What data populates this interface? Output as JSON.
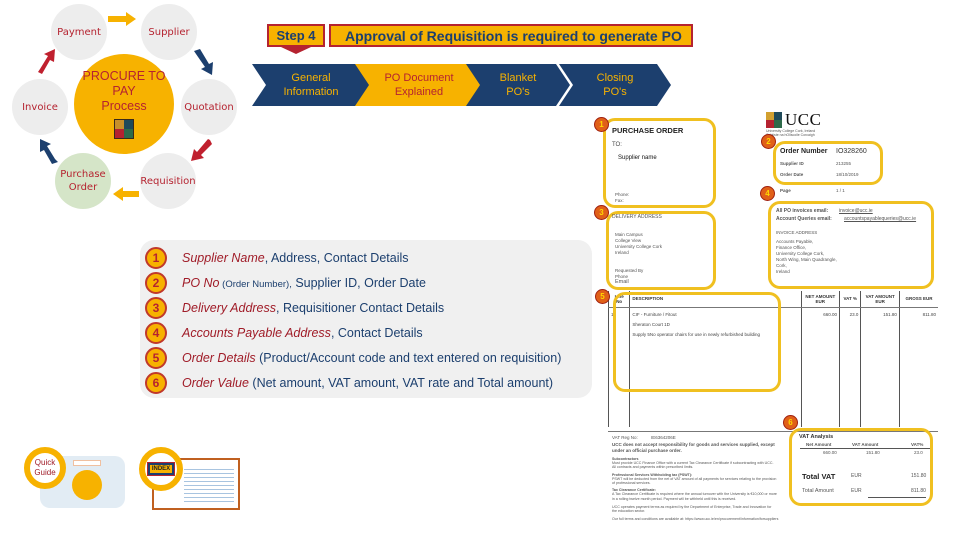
{
  "cycle": {
    "center_line1": "PROCURE TO PAY",
    "center_line2": "Process",
    "nodes": {
      "payment": "Payment",
      "supplier": "Supplier",
      "quotation": "Quotation",
      "requisition": "Requisition",
      "purchase_order_line1": "Purchase",
      "purchase_order_line2": "Order",
      "invoice": "Invoice"
    },
    "colors": {
      "gold": "#f7b200",
      "navy": "#1c3f6e",
      "red": "#b52330",
      "grey": "#ededed",
      "green": "#d5e5c8"
    }
  },
  "header": {
    "step_label": "Step 4",
    "title": "Approval of Requisition is required to generate PO"
  },
  "chevrons": [
    {
      "line1": "General",
      "line2": "Information",
      "active": false
    },
    {
      "line1": "PO Document",
      "line2": "Explained",
      "active": true
    },
    {
      "line1": "Blanket",
      "line2": "PO's",
      "active": false
    },
    {
      "line1": "Closing",
      "line2": "PO's",
      "active": false
    }
  ],
  "list": [
    {
      "num": "1",
      "em": "Supplier Name",
      "rest": ", Address, Contact Details"
    },
    {
      "num": "2",
      "em": "PO No",
      "small": " (Order Number),",
      "rest": " Supplier ID, Order Date"
    },
    {
      "num": "3",
      "em": "Delivery Address",
      "rest": ", Requisitioner Contact Details"
    },
    {
      "num": "4",
      "em": "Accounts Payable Address",
      "rest": ", Contact Details"
    },
    {
      "num": "5",
      "em": "Order Details",
      "rest": " (Product/Account code and text entered on requisition)"
    },
    {
      "num": "6",
      "em": "Order Value",
      "rest": " (Net amount, VAT amount, VAT rate and Total amount)"
    }
  ],
  "po_document": {
    "heading": "PURCHASE ORDER",
    "to_label": "TO:",
    "supplier_name": "Supplier name",
    "phone_label": "Phone:",
    "fax_label": "Fax:",
    "logo_text": "UCC",
    "logo_sub1": "University College Cork, Ireland",
    "logo_sub2": "Coláiste na hOllscoile Corcaigh",
    "order_number_label": "Order Number",
    "order_number": "IO328260",
    "supplier_id_label": "Supplier ID",
    "supplier_id": "213255",
    "order_date_label": "Order Date",
    "order_date": "18/10/2019",
    "page_label": "Page",
    "page_value": "1 / 1",
    "delivery_heading": "DELIVERY ADDRESS",
    "delivery_lines": [
      "Main Campus",
      "College View",
      "University College Cork",
      "Ireland"
    ],
    "requested_by_label": "Requested By",
    "requested_phone": "Phone",
    "requested_email": "Email",
    "invoices_email_label": "All PO invoices email:",
    "invoices_email": "invoice@ucc.ie",
    "queries_email_label": "Account Queries email:",
    "queries_email": "accountspayablequeries@ucc.ie",
    "invoice_heading": "INVOICE ADDRESS",
    "invoice_lines": [
      "Accounts Payable,",
      "Finance Office,",
      "University College Cork,",
      "North Wing, Main Quadrangle,",
      "Cork,",
      "Ireland"
    ],
    "table_headers": [
      "Line No",
      "DESCRIPTION",
      "NET AMOUNT EUR",
      "VAT %",
      "VAT AMOUNT EUR",
      "GROSS EUR"
    ],
    "line_item": {
      "line_no": "1",
      "category": "CIF - Furniture / Fitout",
      "location": "Sheraton Court 1D",
      "description": "Supply 5No operator chairs for use in newly refurbished building",
      "net_amount": "660.00",
      "vat_pct": "23.0",
      "vat_amount": "151.80",
      "gross": "811.80"
    },
    "vat_reg_label": "VAT Reg No:",
    "vat_reg": "IE6364206E",
    "disclaimer": "UCC does not accept responsibility for goods and services supplied, except under an official purchase order.",
    "notes": [
      {
        "title": "Subcontractors",
        "body": "Must provide UCC Finance Office with a current Tax Clearance Certificate if subcontracting with UCC. All contracts and payments within prescribed limits."
      },
      {
        "title": "Professional Services Withholding tax (PSWT):",
        "body": "PSWT will be deducted from the net of VAT amount of all payments for services relating to the provision of professional services."
      },
      {
        "title": "Tax Clearance Certificate:",
        "body": "A Tax Clearance Certificate is required where the annual turnover with the University is €10,000 or more in a rolling twelve month period. Payment will be withheld until this is received."
      },
      {
        "title": "",
        "body": "UCC operates payment terms as required by the Department of Enterprise, Trade and Innovation for the education sector."
      },
      {
        "title": "",
        "body": "Our full terms and conditions are available at: https://www.ucc.ie/en/procurement/information/forsuppliers"
      }
    ],
    "vat_analysis": {
      "title": "VAT Analysis",
      "headers": [
        "Net Amount",
        "VAT Amount",
        "VAT%"
      ],
      "net": "660.00",
      "vat": "151.80",
      "rate": "23.0",
      "total_vat_label": "Total VAT",
      "total_vat_currency": "EUR",
      "total_vat": "151.80",
      "total_amount_label": "Total Amount",
      "total_amount_currency": "EUR",
      "total_amount": "811.80"
    },
    "badges": [
      "1",
      "2",
      "3",
      "4",
      "5",
      "6"
    ]
  },
  "bottom": {
    "quick_guide_line1": "Quick",
    "quick_guide_line2": "Guide",
    "index_label": "INDEX"
  }
}
